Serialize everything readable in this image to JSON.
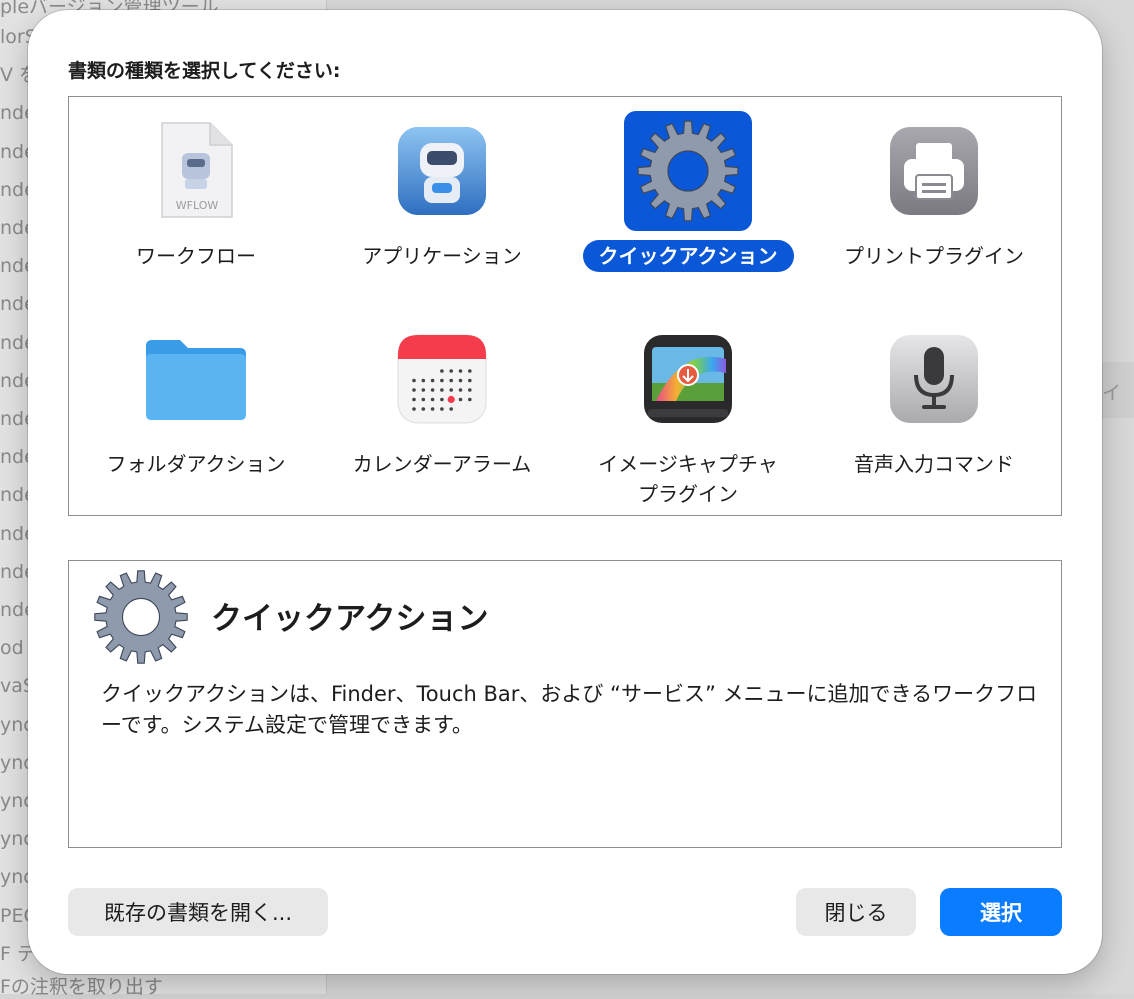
{
  "background": {
    "top_text": "pleバージョン管理ツール",
    "rows": [
      "lorS",
      "V を",
      "nde",
      "nde",
      "nde",
      "nde",
      "nde",
      "nde",
      "nde",
      "nde",
      "nde",
      "nde",
      "nde",
      "nde",
      "nde",
      "nde",
      "od を",
      "vaS",
      "ync",
      "ync",
      "ync",
      "ync",
      "ync",
      "PEG",
      "F デ"
    ],
    "bottom_text": "Fの注釈を取り出す",
    "right_tab": "イ"
  },
  "dialog": {
    "prompt": "書類の種類を選択してください:",
    "tiles": [
      {
        "label": "ワークフロー",
        "icon": "wflow-document-icon",
        "file_badge": "WFLOW"
      },
      {
        "label": "アプリケーション",
        "icon": "automator-robot-icon"
      },
      {
        "label": "クイックアクション",
        "icon": "gear-icon",
        "selected": true
      },
      {
        "label": "プリントプラグイン",
        "icon": "printer-icon"
      },
      {
        "label": "フォルダアクション",
        "icon": "folder-icon"
      },
      {
        "label": "カレンダーアラーム",
        "icon": "calendar-alarm-icon"
      },
      {
        "label": "イメージキャプチャ\nプラグイン",
        "icon": "image-capture-icon"
      },
      {
        "label": "音声入力コマンド",
        "icon": "microphone-icon"
      }
    ],
    "description": {
      "title": "クイックアクション",
      "text": "クイックアクションは、Finder、Touch Bar、および “サービス” メニューに追加できるワークフローです。システム設定で管理できます。"
    },
    "buttons": {
      "open_existing": "既存の書類を開く...",
      "close": "閉じる",
      "choose": "選択"
    }
  },
  "colors": {
    "accent": "#0a58d8",
    "primary_button": "#0a7cff"
  }
}
